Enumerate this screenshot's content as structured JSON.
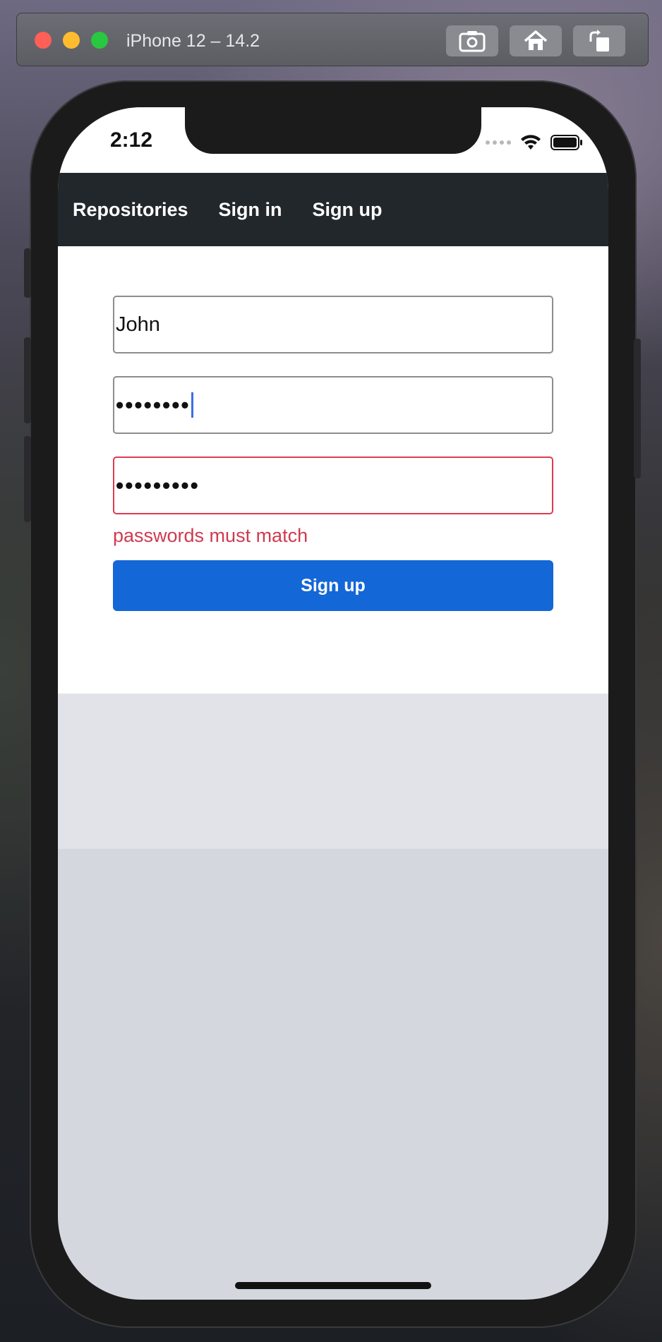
{
  "simulator": {
    "title": "iPhone 12 – 14.2",
    "buttons": [
      "screenshot-icon",
      "home-icon",
      "rotate-icon"
    ]
  },
  "status_bar": {
    "time": "2:12"
  },
  "navbar": {
    "links": [
      "Repositories",
      "Sign in",
      "Sign up"
    ]
  },
  "form": {
    "username_value": "John",
    "password_value": "••••••••",
    "confirm_password_value": "•••••••••",
    "error_message": "passwords must match",
    "submit_label": "Sign up"
  },
  "colors": {
    "navbar_bg": "#22272b",
    "primary_button": "#1467d6",
    "error": "#dc3b52"
  }
}
